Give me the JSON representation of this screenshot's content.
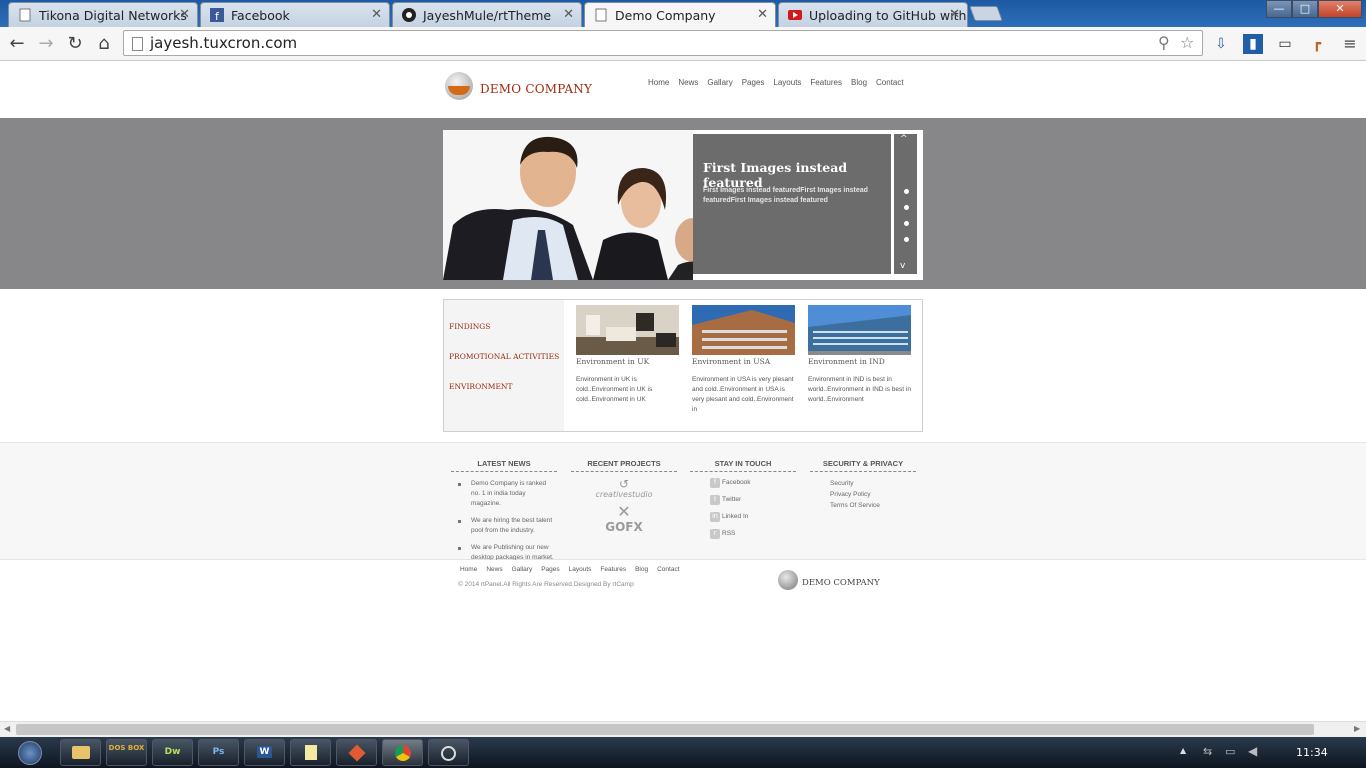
{
  "browser": {
    "tabs": [
      {
        "title": "Tikona Digital Networks",
        "icon": "page-icon",
        "active": false
      },
      {
        "title": "Facebook",
        "icon": "facebook-icon",
        "active": false
      },
      {
        "title": "JayeshMule/rtTheme",
        "icon": "github-icon",
        "active": false
      },
      {
        "title": "Demo Company",
        "icon": "page-icon",
        "active": true
      },
      {
        "title": "Uploading to GitHub with",
        "icon": "youtube-icon",
        "active": false
      }
    ],
    "close_glyph": "✕",
    "url": "jayesh.tuxcron.com",
    "nav_icons": {
      "back": "←",
      "forward": "→",
      "reload": "↻",
      "home": "⌂"
    },
    "window_controls": {
      "minimize": "—",
      "maximize": "□",
      "close": "✕"
    },
    "colors": {
      "tabbar": "#1d5aa3",
      "toolbar": "#f6f6f6"
    }
  },
  "site": {
    "logo_text": "DEMO COMPANY",
    "nav": [
      "Home",
      "News",
      "Gallary",
      "Pages",
      "Layouts",
      "Features",
      "Blog",
      "Contact"
    ],
    "slider": {
      "title": "First Images instead featured",
      "text": "First Images instead featuredFirst Images instead featuredFirst Images instead featured",
      "up_arrow": "^",
      "down_arrow": "v"
    },
    "sidebar_links": [
      "FINDINGS",
      "PROMOTIONAL ACTIVITIES",
      "ENVIRONMENT"
    ],
    "cards": [
      {
        "title": "Environment in UK",
        "text": "Environment in UK is cold..Environment in UK is cold..Environment in UK"
      },
      {
        "title": "Environment in USA",
        "text": "Environment in USA is very plesant and cold..Environment in USA is very plesant and cold..Environment in"
      },
      {
        "title": "Environment in IND",
        "text": "Environment in IND is best in world..Environment in IND is best in world..Environment"
      }
    ],
    "footer": {
      "latest_news": {
        "heading": "LATEST NEWS",
        "items": [
          "Demo Company is ranked no. 1 in india today magazine.",
          "We are hiring the best talent pool from the industry.",
          "We are Publishing our new desktop packages in market."
        ]
      },
      "recent_projects": {
        "heading": "RECENT PROJECTS",
        "logos": [
          "creativestudio",
          "GOFX"
        ]
      },
      "stay_in_touch": {
        "heading": "STAY IN TOUCH",
        "links": [
          {
            "label": "Facebook",
            "icon": "f"
          },
          {
            "label": "Twitter",
            "icon": "t"
          },
          {
            "label": "Linked In",
            "icon": "in"
          },
          {
            "label": "RSS",
            "icon": "r"
          }
        ]
      },
      "security": {
        "heading": "SECURITY & PRIVACY",
        "links": [
          "Security",
          "Privacy Policy",
          "Terms Of Service"
        ]
      }
    },
    "bottom_nav": [
      "Home",
      "News",
      "Gallary",
      "Pages",
      "Layouts",
      "Features",
      "Blog",
      "Contact"
    ],
    "copyright": "© 2014 rtPanel.All Rights Are Reserved.Designed By rtCamp",
    "bottom_logo_text": "DEMO COMPANY"
  },
  "taskbar": {
    "items": [
      {
        "name": "explorer",
        "label": ""
      },
      {
        "name": "dosbox",
        "label": "DOS BOX"
      },
      {
        "name": "dreamweaver",
        "label": "Dw"
      },
      {
        "name": "photoshop",
        "label": "Ps"
      },
      {
        "name": "word",
        "label": "W"
      },
      {
        "name": "notepad",
        "label": ""
      },
      {
        "name": "git",
        "label": ""
      },
      {
        "name": "chrome",
        "label": ""
      },
      {
        "name": "media",
        "label": ""
      }
    ],
    "clock": "11:34"
  }
}
